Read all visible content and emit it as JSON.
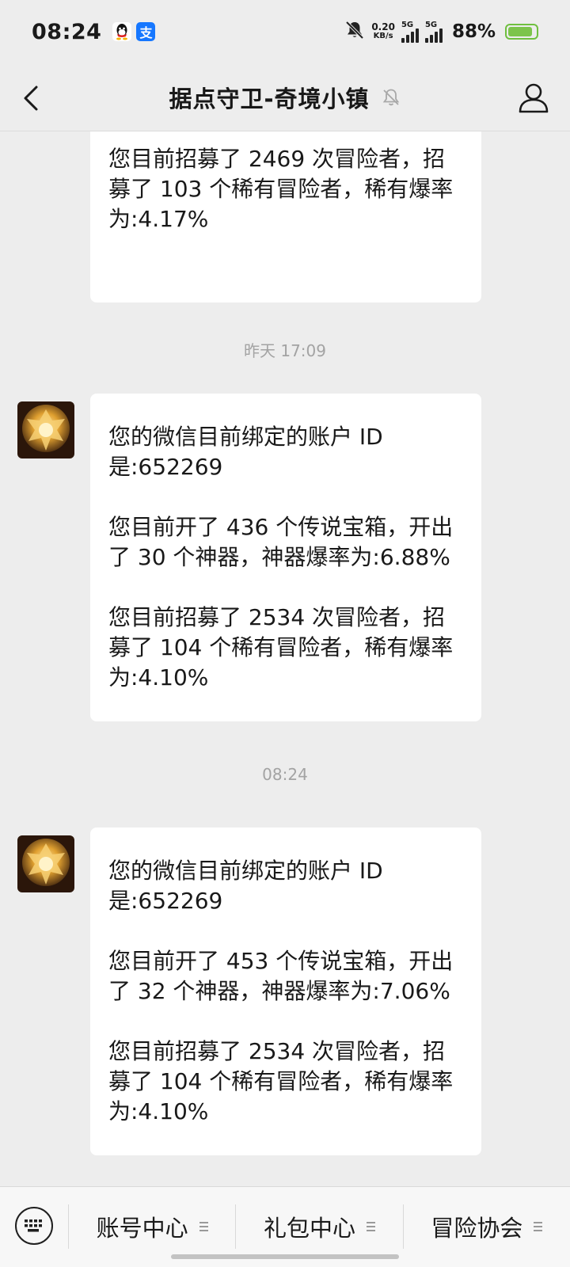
{
  "status_bar": {
    "time": "08:24",
    "net_speed_value": "0.20",
    "net_speed_unit": "KB/s",
    "signal_1_label": "5G",
    "signal_2_label": "5G",
    "battery_text": "88%",
    "battery_level": 0.88,
    "alipay_glyph": "支",
    "icons": [
      "qq-icon",
      "alipay-icon",
      "mute-bell-icon",
      "signal-icon",
      "battery-icon"
    ]
  },
  "nav": {
    "title": "据点守卫-奇境小镇",
    "icons": [
      "back-arrow-icon",
      "mute-bell-icon",
      "person-icon"
    ]
  },
  "messages": [
    {
      "paragraphs": [
        "您目前招募了 2469 次冒险者，招募了 103 个稀有冒险者，稀有爆率为:4.17%"
      ]
    },
    {
      "timestamp": "昨天 17:09",
      "paragraphs": [
        "您的微信目前绑定的账户 ID 是:652269",
        "您目前开了 436 个传说宝箱，开出了 30 个神器，神器爆率为:6.88%",
        "您目前招募了 2534 次冒险者，招募了 104 个稀有冒险者，稀有爆率为:4.10%"
      ]
    },
    {
      "timestamp": "08:24",
      "paragraphs": [
        "您的微信目前绑定的账户 ID 是:652269",
        "您目前开了 453 个传说宝箱，开出了 32 个神器，神器爆率为:7.06%",
        "您目前招募了 2534 次冒险者，招募了 104 个稀有冒险者，稀有爆率为:4.10%"
      ]
    }
  ],
  "bottom_menu": {
    "keyboard_icon": "keyboard-icon",
    "items": [
      {
        "label": "账号中心"
      },
      {
        "label": "礼包中心"
      },
      {
        "label": "冒险协会"
      }
    ]
  }
}
